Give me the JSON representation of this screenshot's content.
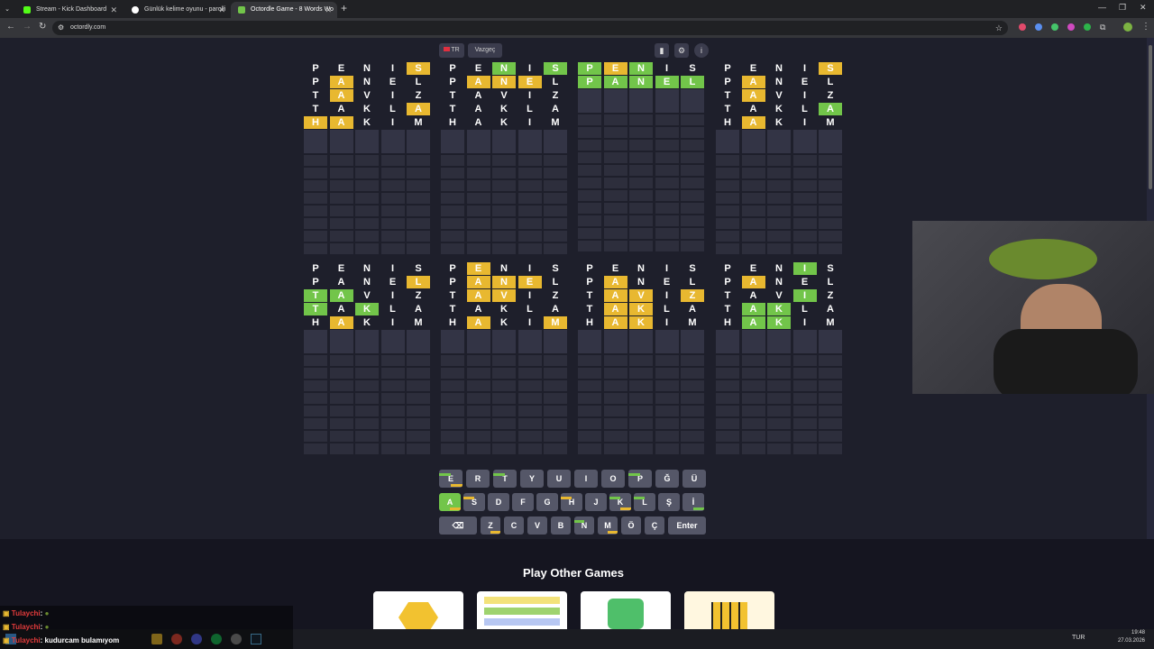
{
  "browser": {
    "tabs": [
      {
        "title": "Stream - Kick Dashboard",
        "color": "#53fc18"
      },
      {
        "title": "Günlük kelime oyunu - parolli",
        "color": "#ffffff"
      },
      {
        "title": "Octordle Game - 8 Words Wo",
        "color": "#72c54a"
      }
    ],
    "url": "octordly.com",
    "lang": "TUR",
    "time": "19:48",
    "date": "27.03.2026"
  },
  "toolbar": {
    "lang_label": "TR",
    "giveup_label": "Vazgeç"
  },
  "guesses": [
    "PENIS",
    "PANEL",
    "TAVIZ",
    "TAKLA",
    "HAKIM"
  ],
  "boards": [
    {
      "rows": [
        "nnnny",
        "nynnn",
        "nynnn",
        "nnnny",
        "yynnn"
      ],
      "filled": 5,
      "empty": 9
    },
    {
      "rows": [
        "nngng",
        "nyyyn",
        "nnnnn",
        "nnnnn",
        "nnnnn"
      ],
      "filled": 5,
      "empty": 9
    },
    {
      "rows": [
        "gygnn",
        "ggggg"
      ],
      "filled": 2,
      "empty": 12
    },
    {
      "rows": [
        "nnnny",
        "nynnn",
        "nynnn",
        "nnnng",
        "nynnn"
      ],
      "filled": 5,
      "empty": 9
    },
    {
      "rows": [
        "nnnnn",
        "nnnny",
        "ggnnn",
        "gngnn",
        "nynnn"
      ],
      "filled": 5,
      "empty": 9
    },
    {
      "rows": [
        "nyncn",
        "nyyyn",
        "nyynn",
        "nnnnn",
        "nynny"
      ],
      "filled": 5,
      "empty": 9
    },
    {
      "rows": [
        "nnnnn",
        "nynnn",
        "nyyny",
        "nyynn",
        "nyynn"
      ],
      "filled": 5,
      "empty": 9
    },
    {
      "rows": [
        "nnngn",
        "nynnn",
        "nnngn",
        "nggnn",
        "nggnn"
      ],
      "filled": 5,
      "empty": 9
    }
  ],
  "keyboard": {
    "row1": [
      "E",
      "R",
      "T",
      "Y",
      "U",
      "I",
      "O",
      "P",
      "Ğ",
      "Ü"
    ],
    "row2": [
      "A",
      "S",
      "D",
      "F",
      "G",
      "H",
      "J",
      "K",
      "L",
      "Ş",
      "İ"
    ],
    "row3": [
      "⌫",
      "Z",
      "C",
      "V",
      "B",
      "N",
      "M",
      "Ö",
      "Ç",
      "Enter"
    ]
  },
  "footer": {
    "title": "Play Other Games"
  },
  "chat": [
    {
      "user": "Tulaychi",
      "text": ":"
    },
    {
      "user": "Tulaychi",
      "text": ":"
    },
    {
      "user": "Tulaychi",
      "text": ": kudurcam bulamıyom"
    }
  ],
  "colors": {
    "green": "#72c54a",
    "yellow": "#e8b830",
    "bg": "#1e1f2b",
    "empty": "#2d2e3c"
  }
}
